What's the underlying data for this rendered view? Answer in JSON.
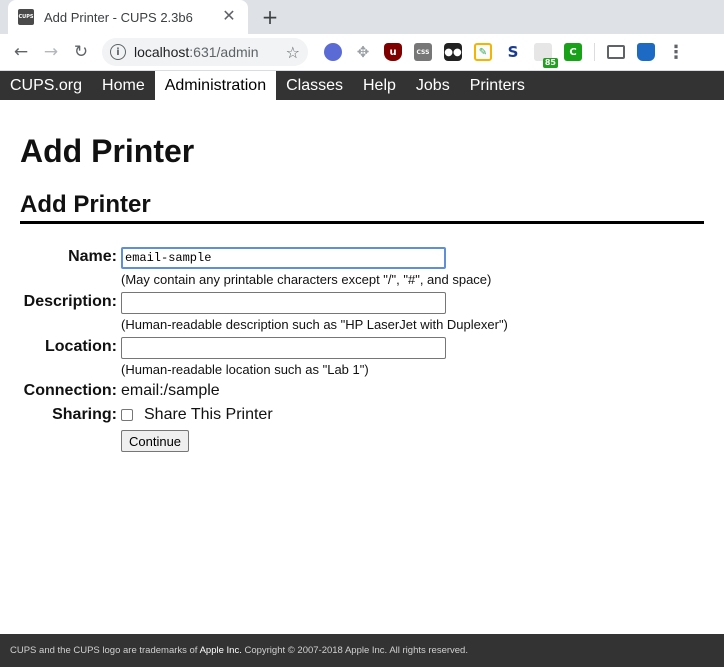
{
  "browser": {
    "tab_title": "Add Printer - CUPS 2.3b6",
    "tab_favicon_text": "CUPS",
    "close_glyph": "✕",
    "new_tab_glyph": "+",
    "url_host": "localhost",
    "url_rest": ":631/admin",
    "ext_badge": "85"
  },
  "nav": {
    "items": [
      "CUPS.org",
      "Home",
      "Administration",
      "Classes",
      "Help",
      "Jobs",
      "Printers"
    ],
    "active": "Administration"
  },
  "page": {
    "title": "Add Printer",
    "section_title": "Add Printer"
  },
  "form": {
    "name_label": "Name:",
    "name_value": "email-sample",
    "name_hint": "(May contain any printable characters except \"/\", \"#\", and space)",
    "description_label": "Description:",
    "description_value": "",
    "description_hint": "(Human-readable description such as \"HP LaserJet with Duplexer\")",
    "location_label": "Location:",
    "location_value": "",
    "location_hint": "(Human-readable location such as \"Lab 1\")",
    "connection_label": "Connection:",
    "connection_value": "email:/sample",
    "sharing_label": "Sharing:",
    "sharing_checkbox_label": "Share This Printer",
    "sharing_checked": false,
    "continue_label": "Continue"
  },
  "footer": {
    "text_before": "CUPS and the CUPS logo are trademarks of ",
    "apple": "Apple Inc.",
    "text_after": " Copyright © 2007-2018 Apple Inc. All rights reserved."
  },
  "colors": {
    "nav_bg": "#333333",
    "focus_ring": "#5f8fd9"
  }
}
